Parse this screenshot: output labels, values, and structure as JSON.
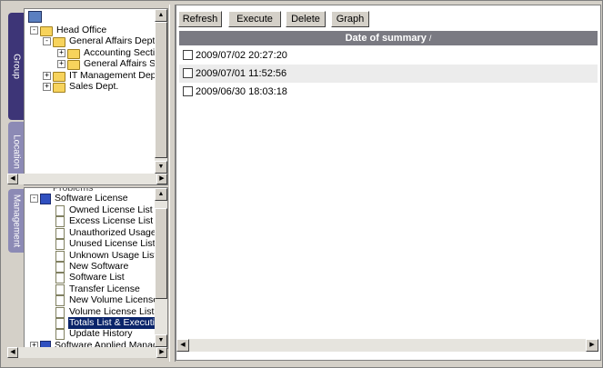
{
  "tabs": {
    "group": "Group",
    "location": "Location",
    "management": "Management"
  },
  "group_tree": [
    {
      "label": "Head Office",
      "level": 0,
      "expander": "-",
      "icon": "folder"
    },
    {
      "label": "General Affairs Dept.",
      "level": 1,
      "expander": "-",
      "icon": "folder"
    },
    {
      "label": "Accounting Section",
      "level": 2,
      "expander": "+",
      "icon": "folder"
    },
    {
      "label": "General Affairs Sec",
      "level": 2,
      "expander": "+",
      "icon": "folder"
    },
    {
      "label": "IT Management Dept.",
      "level": 1,
      "expander": "+",
      "icon": "folder"
    },
    {
      "label": "Sales Dept.",
      "level": 1,
      "expander": "+",
      "icon": "folder"
    }
  ],
  "management_tree": {
    "partial_top": "Problems",
    "parent": "Software License",
    "items": [
      "Owned License List",
      "Excess License List",
      "Unauthorized Usage Li",
      "Unused License List",
      "Unknown Usage List",
      "New Software",
      "Software List",
      "Transfer License",
      "New Volume License",
      "Volume License List",
      "Totals List & Execution",
      "Update History"
    ],
    "selected": "Totals List & Execution",
    "bottom": "Software Applied Managem"
  },
  "toolbar": {
    "refresh": "Refresh",
    "execute": "Execute",
    "delete": "Delete",
    "graph": "Graph"
  },
  "table": {
    "header": "Date of summary",
    "sort_indicator": "/",
    "rows": [
      "2009/07/02 20:27:20",
      "2009/07/01 11:52:56",
      "2009/06/30 18:03:18"
    ]
  },
  "colors": {
    "tab_active": "#3d3577",
    "tab_inactive": "#8c8ab5",
    "header_bg": "#7a7a82",
    "selection": "#0a246a"
  }
}
